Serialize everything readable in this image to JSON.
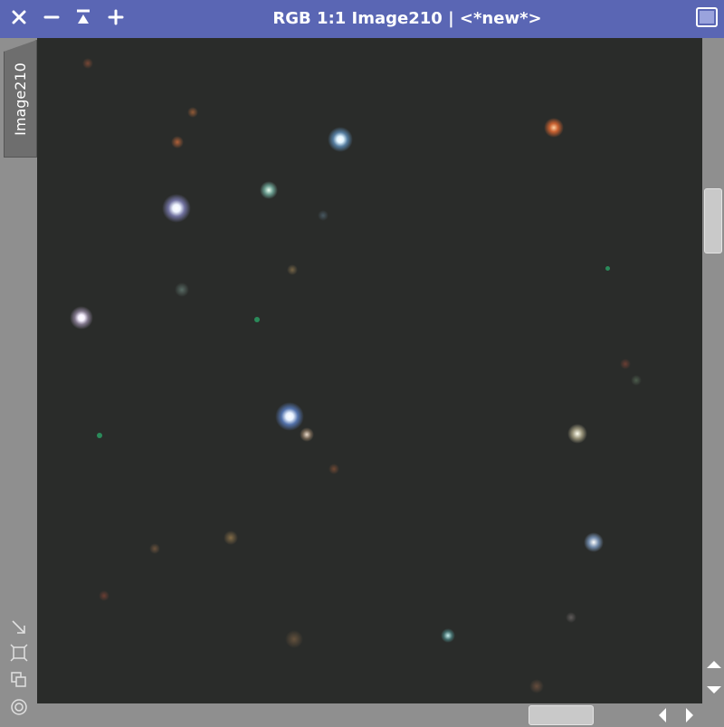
{
  "window": {
    "title": "RGB 1:1 Image210 | <*new*>",
    "title_bar_color": "#5a66b4",
    "buttons": [
      {
        "name": "close",
        "icon": "close-icon"
      },
      {
        "name": "minimize",
        "icon": "minimize-icon"
      },
      {
        "name": "shade",
        "icon": "shade-icon"
      },
      {
        "name": "maximize",
        "icon": "plus-icon"
      },
      {
        "name": "iconize",
        "icon": "window-icon"
      }
    ]
  },
  "view_tab": {
    "label": "Image210"
  },
  "left_tools": [
    {
      "name": "fit-to-window",
      "icon": "diagonal-arrow-icon"
    },
    {
      "name": "zoom-to-fit",
      "icon": "frame-icon"
    },
    {
      "name": "clone-view",
      "icon": "overlap-squares-icon"
    },
    {
      "name": "target",
      "icon": "target-icon"
    }
  ],
  "image": {
    "background_color": "#2a2c2a",
    "content": "star field"
  },
  "scrollbars": {
    "vertical": {
      "icons": [
        "arrow-up-icon",
        "arrow-down-icon"
      ]
    },
    "horizontal": {
      "icons": [
        "arrow-left-icon",
        "arrow-right-icon"
      ]
    }
  }
}
